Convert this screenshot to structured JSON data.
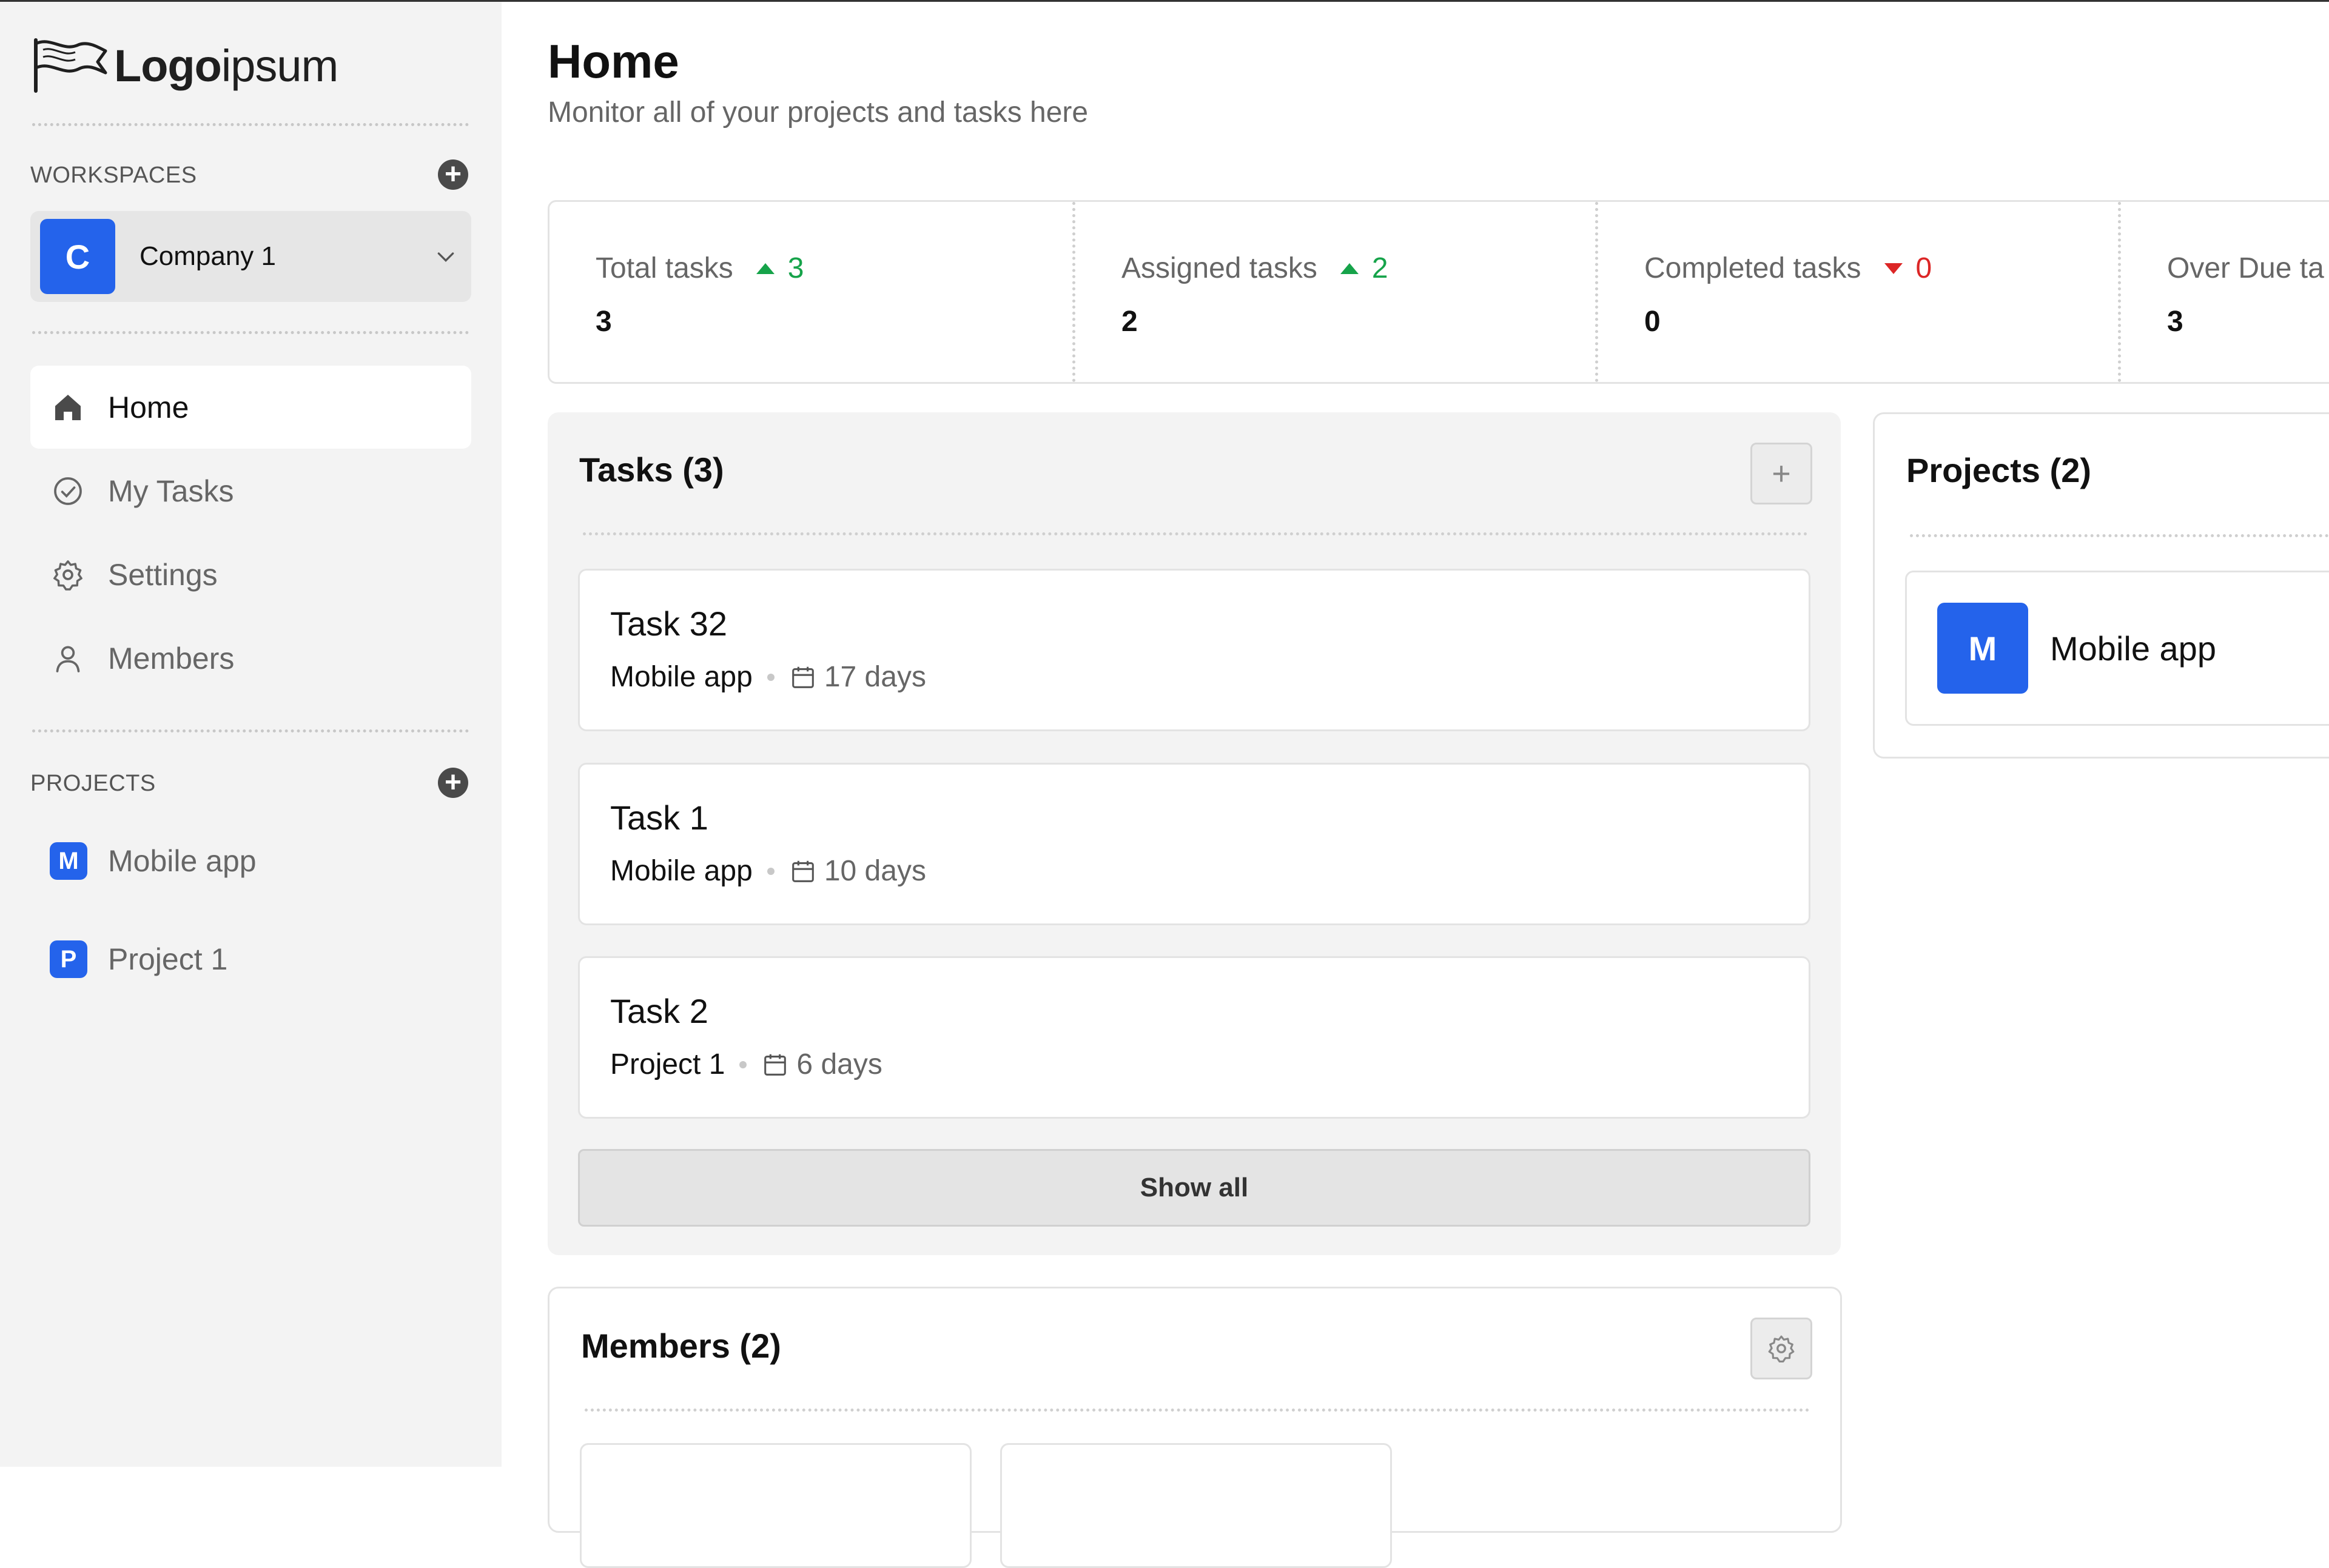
{
  "brand": {
    "logo_bold": "Logo",
    "logo_light": "ipsum"
  },
  "sidebar": {
    "workspaces_label": "WORKSPACES",
    "workspace": {
      "initial": "C",
      "name": "Company 1"
    },
    "nav": [
      {
        "label": "Home",
        "icon": "home-icon",
        "active": true
      },
      {
        "label": "My Tasks",
        "icon": "check-circle-icon"
      },
      {
        "label": "Settings",
        "icon": "gear-icon"
      },
      {
        "label": "Members",
        "icon": "user-icon"
      }
    ],
    "projects_label": "PROJECTS",
    "projects": [
      {
        "initial": "M",
        "name": "Mobile app"
      },
      {
        "initial": "P",
        "name": "Project 1"
      }
    ]
  },
  "header": {
    "title": "Home",
    "subtitle": "Monitor all of your projects and tasks here"
  },
  "stats": [
    {
      "label": "Total tasks",
      "delta": "3",
      "direction": "up",
      "value": "3"
    },
    {
      "label": "Assigned tasks",
      "delta": "2",
      "direction": "up",
      "value": "2"
    },
    {
      "label": "Completed tasks",
      "delta": "0",
      "direction": "down",
      "value": "0"
    },
    {
      "label": "Over Due ta",
      "value": "3"
    }
  ],
  "tasks_panel": {
    "title": "Tasks (3)",
    "add_label": "+",
    "items": [
      {
        "title": "Task 32",
        "project": "Mobile app",
        "days": "17 days"
      },
      {
        "title": "Task 1",
        "project": "Mobile app",
        "days": "10 days"
      },
      {
        "title": "Task 2",
        "project": "Project 1",
        "days": "6 days"
      }
    ],
    "show_all": "Show all"
  },
  "projects_panel": {
    "title": "Projects (2)",
    "items": [
      {
        "initial": "M",
        "name": "Mobile app"
      }
    ]
  },
  "members_panel": {
    "title": "Members (2)"
  },
  "colors": {
    "accent": "#2463eb",
    "up": "#16a34a",
    "down": "#dc2626",
    "sidebar_bg": "#f3f3f3"
  }
}
